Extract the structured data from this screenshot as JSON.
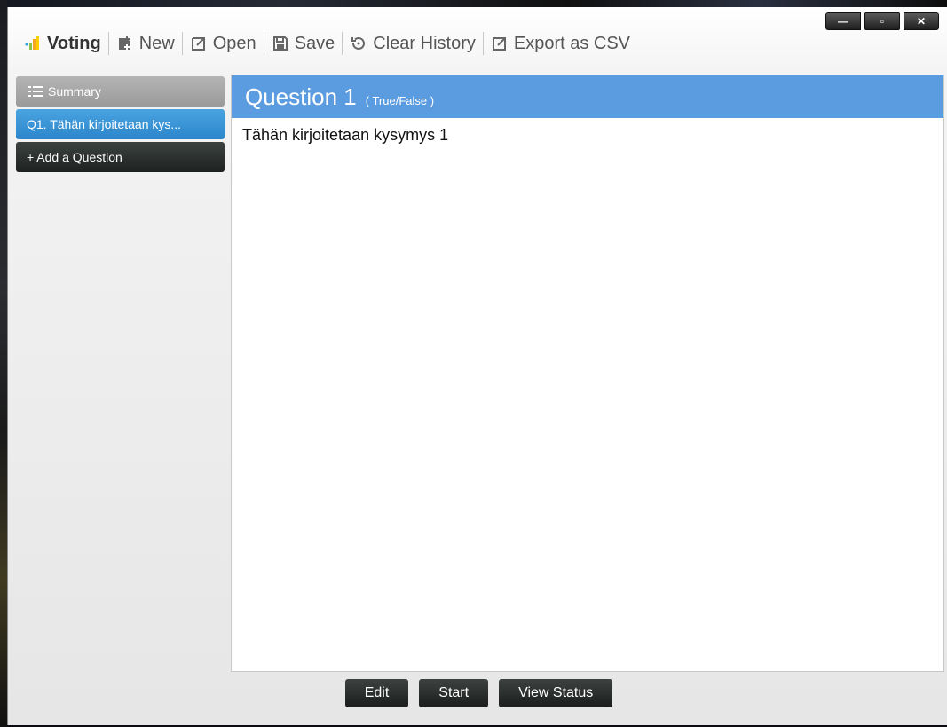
{
  "window": {
    "controls": {
      "minimize": "—",
      "maximize": "▫",
      "close": "✕"
    }
  },
  "toolbar": {
    "app_name": "Voting",
    "new_label": "New",
    "open_label": "Open",
    "save_label": "Save",
    "clear_history_label": "Clear History",
    "export_label": "Export as CSV"
  },
  "sidebar": {
    "summary_label": "Summary",
    "questions": [
      {
        "label": "Q1. Tähän kirjoitetaan kys..."
      }
    ],
    "add_question_label": "+ Add a Question"
  },
  "question": {
    "title": "Question 1",
    "type": "( True/False )",
    "text": "Tähän kirjoitetaan kysymys 1"
  },
  "footer": {
    "edit_label": "Edit",
    "start_label": "Start",
    "view_status_label": "View Status"
  },
  "colors": {
    "accent": "#5b9be0",
    "selected_question": "#2b86cc",
    "dark_button": "#1d2120"
  }
}
